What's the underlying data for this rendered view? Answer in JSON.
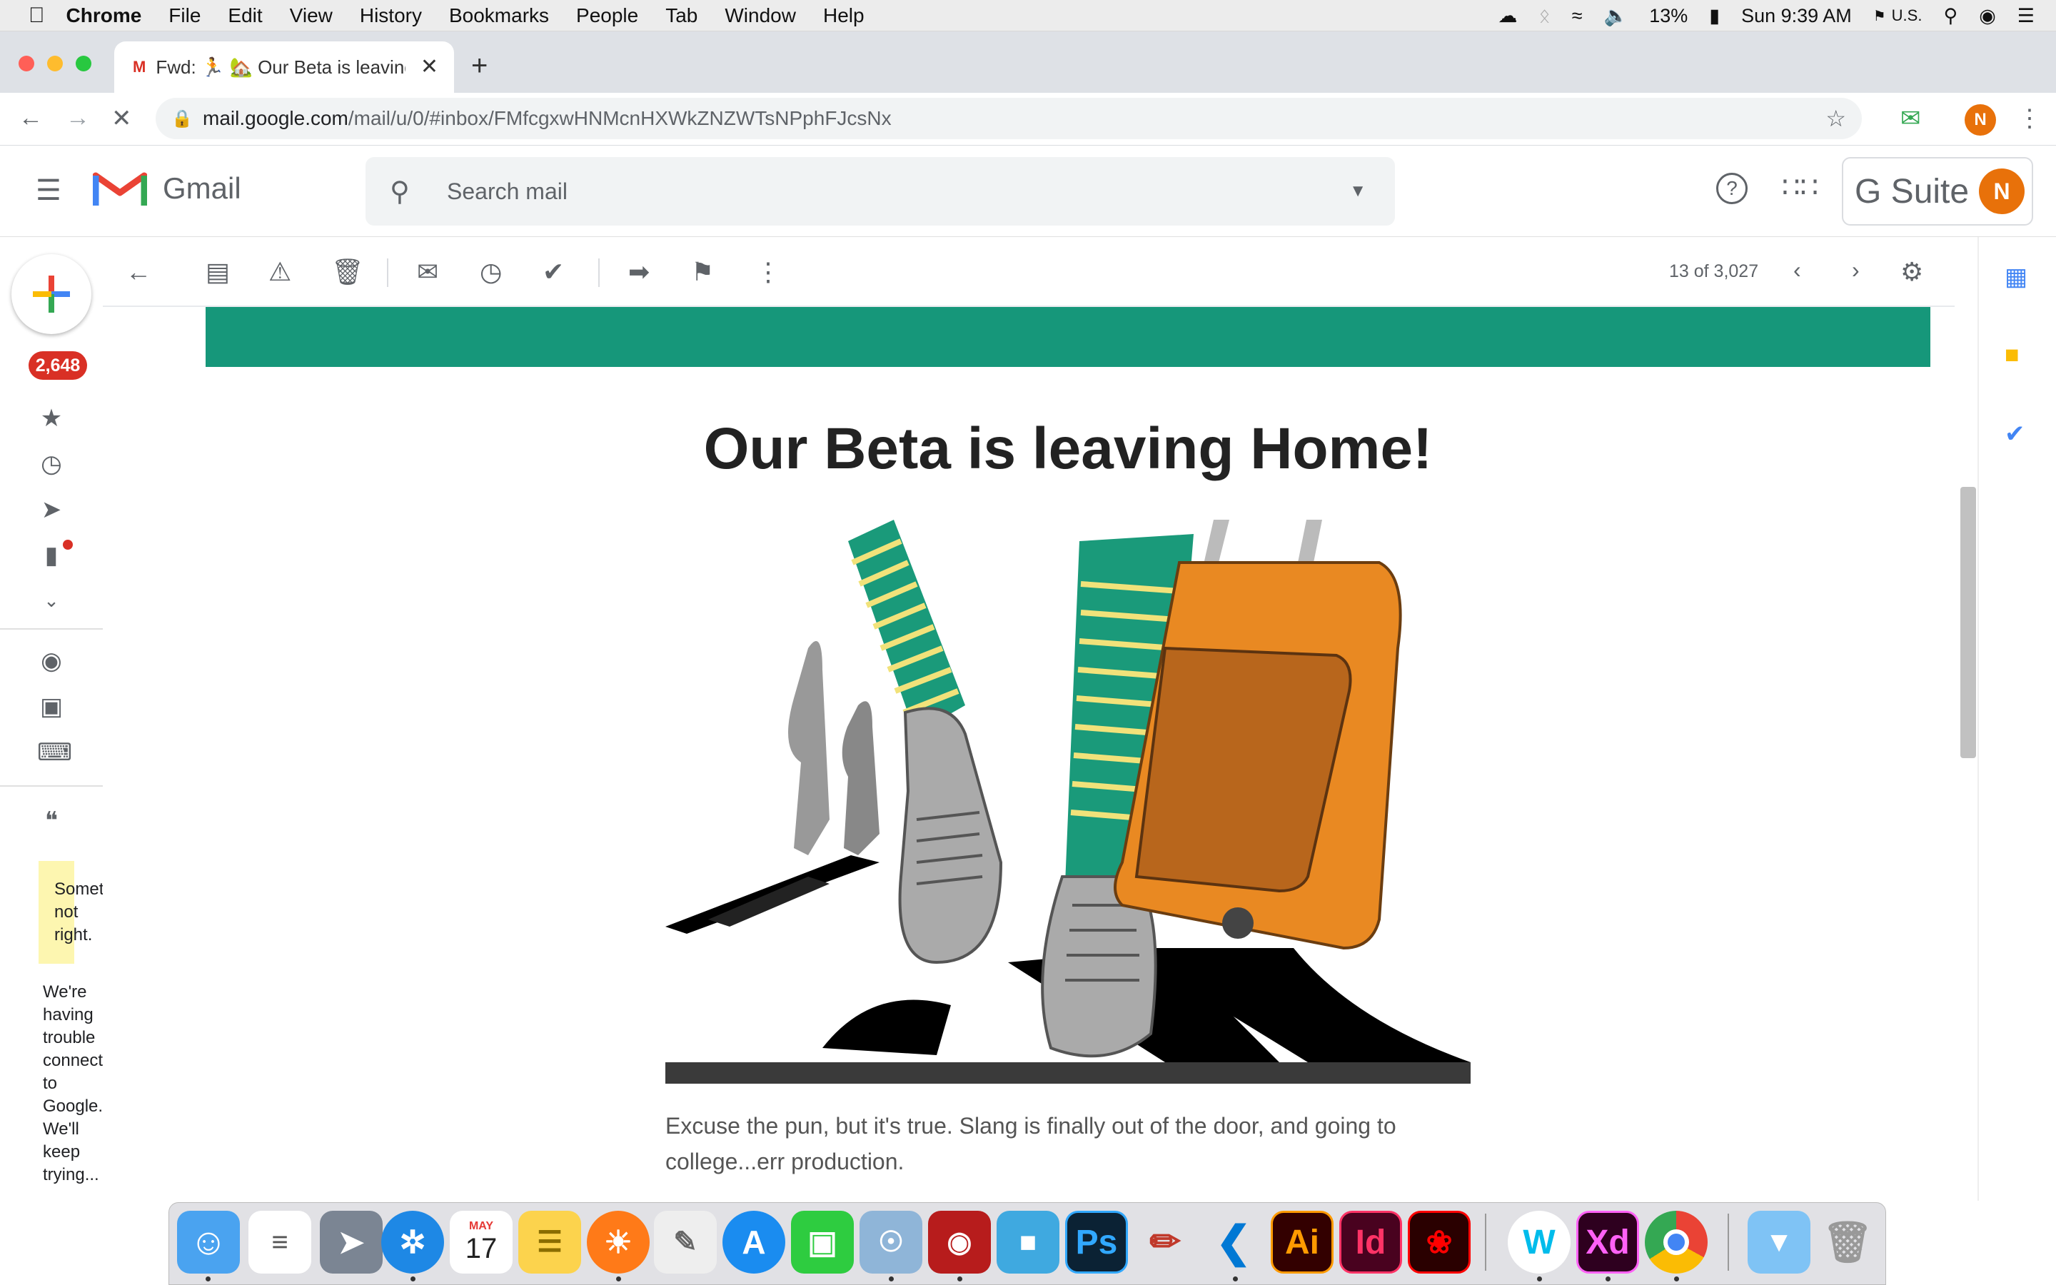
{
  "menubar": {
    "app": "Chrome",
    "items": [
      "File",
      "Edit",
      "View",
      "History",
      "Bookmarks",
      "People",
      "Tab",
      "Window",
      "Help"
    ],
    "battery": "13%",
    "clock": "Sun 9:39 AM",
    "input_source": "U.S."
  },
  "browser": {
    "tab_title": "Fwd: 🏃 🏡 Our Beta is leaving",
    "url_host": "mail.google.com",
    "url_path": "/mail/u/0/#inbox/FMfcgxwHNMcnHXWkZNZWTsNPphFJcsNx",
    "profile_initial": "N"
  },
  "gmail": {
    "logo_text": "Gmail",
    "search_placeholder": "Search mail",
    "gsuite_label": "G Suite",
    "account_initial": "N",
    "inbox_badge": "2,648",
    "pager": "13 of 3,027",
    "hangouts_warning_1": "Somet\nnot\nright.",
    "hangouts_warning_2": "We're\nhaving\ntrouble\nconnect\nto\nGoogle.\nWe'll\nkeep\ntrying..."
  },
  "email": {
    "headline": "Our Beta is leaving Home!",
    "intro": "Excuse the pun, but it's true. Slang is finally out of the door, and going to college...err production.",
    "accent_color": "#16977a"
  },
  "dock": {
    "apps": [
      "finder",
      "reminders",
      "launchpad",
      "safari",
      "calendar",
      "notes",
      "firefox",
      "textedit",
      "app-store",
      "facetime",
      "preview",
      "photo-booth",
      "sublime",
      "photoshop",
      "pencil",
      "vscode",
      "illustrator",
      "indesign",
      "acrobat",
      "webex",
      "xd",
      "chrome",
      "downloads",
      "trash"
    ],
    "calendar_month": "MAY",
    "calendar_day": "17",
    "photoshop_label": "Ps",
    "illustrator_label": "Ai",
    "indesign_label": "Id",
    "xd_label": "Xd",
    "webex_label": "W"
  }
}
